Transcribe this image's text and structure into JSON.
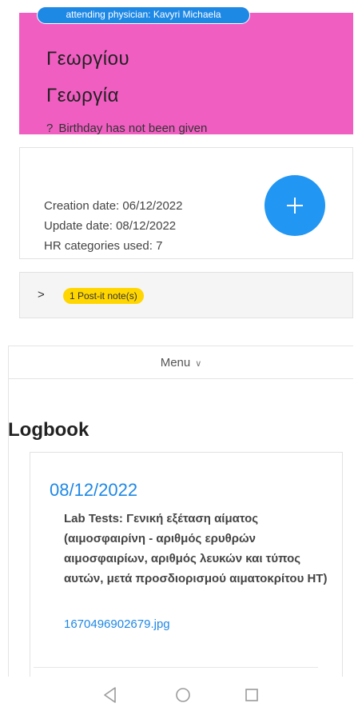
{
  "patient": {
    "physician_badge": "attending physician: Kavyri Michaela",
    "surname": "Γεωργίου",
    "first_name": "Γεωργία",
    "birthday_icon": "?",
    "birthday_text": "Birthday has not been given",
    "header_color": "#f05ec2"
  },
  "record_info": {
    "creation_date": "Creation date: 06/12/2022",
    "update_date": "Update date: 08/12/2022",
    "hr_categories": "HR categories used: 7",
    "add_icon": "plus-icon"
  },
  "postit": {
    "chevron": ">",
    "badge_label": "1 Post-it note(s)"
  },
  "menu": {
    "label": "Menu",
    "chevron": "∨"
  },
  "logbook": {
    "title": "Logbook",
    "entries": [
      {
        "date": "08/12/2022",
        "description": "Lab Tests: Γενική εξέταση αίματος (αιμοσφαιρίνη - αριθμός ερυθρών αιμοσφαιρίων, αριθμός λευκών και τύπος αυτών, μετά προσδιορισμού αιματοκρίτου HT)",
        "attachment": "1670496902679.jpg"
      }
    ]
  },
  "navigation": {
    "back_icon": "back-triangle-icon",
    "home_icon": "home-circle-icon",
    "recent_icon": "recent-square-icon"
  },
  "colors": {
    "accent_blue": "#1e88e5",
    "fab_blue": "#2196f3",
    "postit_yellow": "#ffd600"
  }
}
